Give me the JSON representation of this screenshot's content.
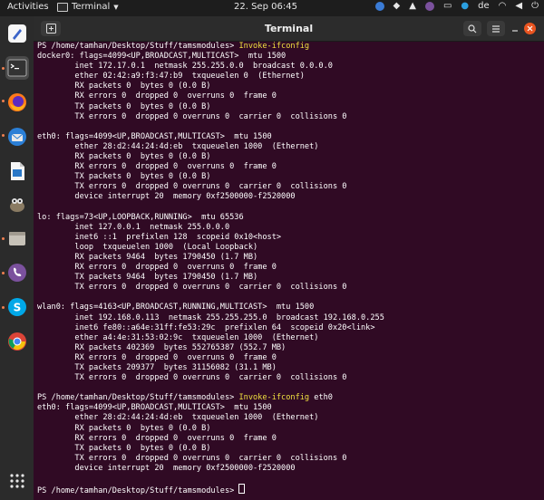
{
  "topbar": {
    "activities": "Activities",
    "app_name": "Terminal",
    "clock": "22. Sep  06:45",
    "language": "de"
  },
  "window": {
    "title": "Terminal"
  },
  "colors": {
    "terminal_bg": "#300a24",
    "command": "#f0e040",
    "text": "#ffffff"
  },
  "dock": {
    "items": [
      {
        "name": "text-editor-icon"
      },
      {
        "name": "terminal-icon"
      },
      {
        "name": "firefox-icon"
      },
      {
        "name": "thunderbird-icon"
      },
      {
        "name": "libreoffice-writer-icon"
      },
      {
        "name": "gimp-icon"
      },
      {
        "name": "files-icon"
      },
      {
        "name": "viber-icon"
      },
      {
        "name": "skype-icon"
      },
      {
        "name": "chrome-icon"
      },
      {
        "name": "app-grid-icon"
      }
    ]
  },
  "terminal": {
    "lines": [
      {
        "prompt": "PS /home/tamhan/Desktop/Stuff/tamsmodules> ",
        "cmd": "Invoke-ifconfig",
        "arg": ""
      },
      {
        "text": "docker0: flags=4099<UP,BROADCAST,MULTICAST>  mtu 1500"
      },
      {
        "text": "        inet 172.17.0.1  netmask 255.255.0.0  broadcast 0.0.0.0"
      },
      {
        "text": "        ether 02:42:a9:f3:47:b9  txqueuelen 0  (Ethernet)"
      },
      {
        "text": "        RX packets 0  bytes 0 (0.0 B)"
      },
      {
        "text": "        RX errors 0  dropped 0  overruns 0  frame 0"
      },
      {
        "text": "        TX packets 0  bytes 0 (0.0 B)"
      },
      {
        "text": "        TX errors 0  dropped 0 overruns 0  carrier 0  collisions 0"
      },
      {
        "text": ""
      },
      {
        "text": "eth0: flags=4099<UP,BROADCAST,MULTICAST>  mtu 1500"
      },
      {
        "text": "        ether 28:d2:44:24:4d:eb  txqueuelen 1000  (Ethernet)"
      },
      {
        "text": "        RX packets 0  bytes 0 (0.0 B)"
      },
      {
        "text": "        RX errors 0  dropped 0  overruns 0  frame 0"
      },
      {
        "text": "        TX packets 0  bytes 0 (0.0 B)"
      },
      {
        "text": "        TX errors 0  dropped 0 overruns 0  carrier 0  collisions 0"
      },
      {
        "text": "        device interrupt 20  memory 0xf2500000-f2520000"
      },
      {
        "text": ""
      },
      {
        "text": "lo: flags=73<UP,LOOPBACK,RUNNING>  mtu 65536"
      },
      {
        "text": "        inet 127.0.0.1  netmask 255.0.0.0"
      },
      {
        "text": "        inet6 ::1  prefixlen 128  scopeid 0x10<host>"
      },
      {
        "text": "        loop  txqueuelen 1000  (Local Loopback)"
      },
      {
        "text": "        RX packets 9464  bytes 1790450 (1.7 MB)"
      },
      {
        "text": "        RX errors 0  dropped 0  overruns 0  frame 0"
      },
      {
        "text": "        TX packets 9464  bytes 1790450 (1.7 MB)"
      },
      {
        "text": "        TX errors 0  dropped 0 overruns 0  carrier 0  collisions 0"
      },
      {
        "text": ""
      },
      {
        "text": "wlan0: flags=4163<UP,BROADCAST,RUNNING,MULTICAST>  mtu 1500"
      },
      {
        "text": "        inet 192.168.0.113  netmask 255.255.255.0  broadcast 192.168.0.255"
      },
      {
        "text": "        inet6 fe80::a64e:31ff:fe53:29c  prefixlen 64  scopeid 0x20<link>"
      },
      {
        "text": "        ether a4:4e:31:53:02:9c  txqueuelen 1000  (Ethernet)"
      },
      {
        "text": "        RX packets 402369  bytes 552765387 (552.7 MB)"
      },
      {
        "text": "        RX errors 0  dropped 0  overruns 0  frame 0"
      },
      {
        "text": "        TX packets 209377  bytes 31156082 (31.1 MB)"
      },
      {
        "text": "        TX errors 0  dropped 0 overruns 0  carrier 0  collisions 0"
      },
      {
        "text": ""
      },
      {
        "prompt": "PS /home/tamhan/Desktop/Stuff/tamsmodules> ",
        "cmd": "Invoke-ifconfig",
        "arg": " eth0"
      },
      {
        "text": "eth0: flags=4099<UP,BROADCAST,MULTICAST>  mtu 1500"
      },
      {
        "text": "        ether 28:d2:44:24:4d:eb  txqueuelen 1000  (Ethernet)"
      },
      {
        "text": "        RX packets 0  bytes 0 (0.0 B)"
      },
      {
        "text": "        RX errors 0  dropped 0  overruns 0  frame 0"
      },
      {
        "text": "        TX packets 0  bytes 0 (0.0 B)"
      },
      {
        "text": "        TX errors 0  dropped 0 overruns 0  carrier 0  collisions 0"
      },
      {
        "text": "        device interrupt 20  memory 0xf2500000-f2520000"
      },
      {
        "text": ""
      },
      {
        "prompt": "PS /home/tamhan/Desktop/Stuff/tamsmodules> ",
        "cmd": "",
        "arg": "",
        "cursor": true
      }
    ]
  }
}
